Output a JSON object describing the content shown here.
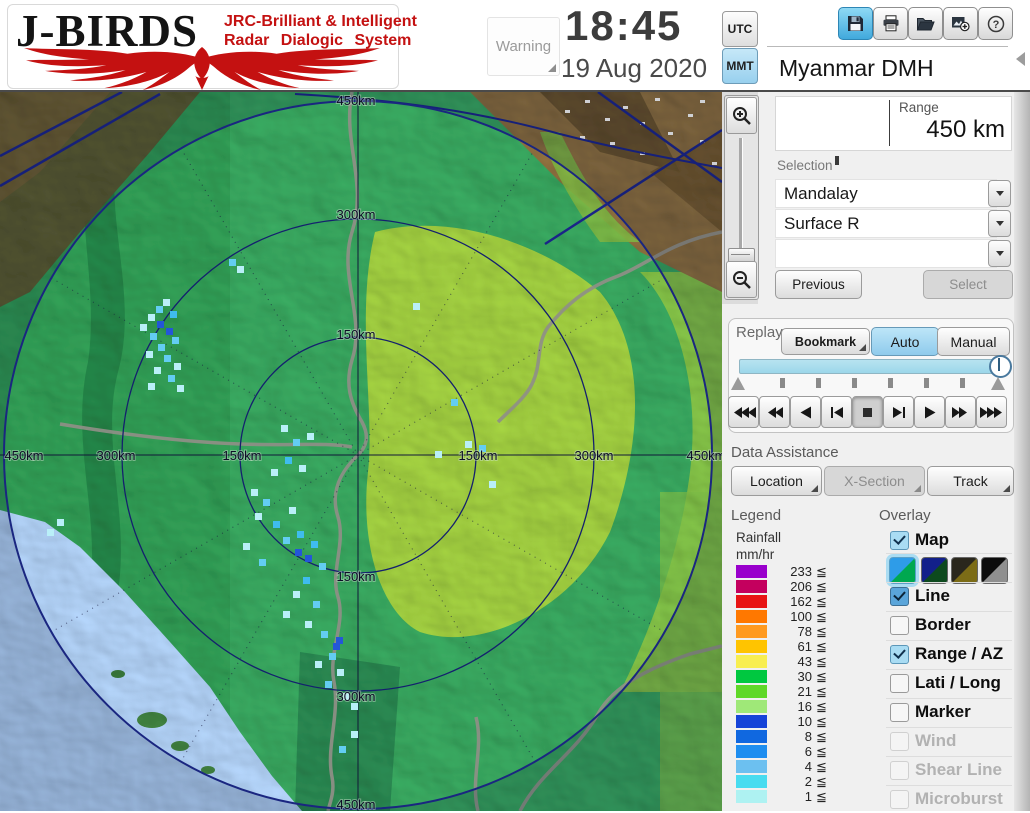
{
  "header": {
    "logo": {
      "title": "J-BIRDS",
      "tagline_line1": "JRC-Brilliant & Intelligent",
      "tagline_line2": "Radar Dialogic System"
    },
    "warning_label": "Warning",
    "clock": {
      "time": "18:45",
      "date": "19 Aug 2020",
      "utc_label": "UTC",
      "mmt_label": "MMT",
      "selected_timezone": "MMT"
    },
    "toolbar_icons": [
      "save",
      "print",
      "open-folder",
      "add-image",
      "help"
    ]
  },
  "station_name": "Myanmar DMH",
  "range": {
    "label": "Range",
    "value": "450 km"
  },
  "selection": {
    "label": "Selection",
    "dropdowns": [
      "Mandalay",
      "Surface R",
      ""
    ],
    "previous_label": "Previous",
    "select_label": "Select"
  },
  "replay": {
    "label": "Replay",
    "bookmark_label": "Bookmark",
    "auto_label": "Auto",
    "manual_label": "Manual",
    "mode_selected": "Auto",
    "playback_icons": [
      "fastest-rewind",
      "fast-rewind",
      "play-backward",
      "step-backward",
      "stop",
      "step-forward",
      "play-forward",
      "fast-forward",
      "fastest-forward"
    ],
    "active_playback": "stop"
  },
  "data_assistance": {
    "label": "Data Assistance",
    "location_label": "Location",
    "xsection_label": "X-Section",
    "track_label": "Track"
  },
  "legend": {
    "label": "Legend",
    "unit_line1": "Rainfall",
    "unit_line2": "mm/hr",
    "le_symbol": "≦",
    "entries": [
      {
        "v": "233",
        "color": "#9900cc"
      },
      {
        "v": "206",
        "color": "#c4005e"
      },
      {
        "v": "162",
        "color": "#e81414"
      },
      {
        "v": "100",
        "color": "#ff7800"
      },
      {
        "v": "78",
        "color": "#ff9a20"
      },
      {
        "v": "61",
        "color": "#ffc400"
      },
      {
        "v": "43",
        "color": "#f8ee50"
      },
      {
        "v": "30",
        "color": "#00c840"
      },
      {
        "v": "21",
        "color": "#5fd828"
      },
      {
        "v": "16",
        "color": "#9fe878"
      },
      {
        "v": "10",
        "color": "#1543d8"
      },
      {
        "v": "8",
        "color": "#1068e0"
      },
      {
        "v": "6",
        "color": "#1e8ef0"
      },
      {
        "v": "4",
        "color": "#6cc0f0"
      },
      {
        "v": "2",
        "color": "#48dcf0"
      },
      {
        "v": "1",
        "color": "#aef2f2"
      }
    ]
  },
  "overlay": {
    "label": "Overlay",
    "items": [
      {
        "label": "Map",
        "state": "checked"
      },
      {
        "label": "Line",
        "state": "checked-dark"
      },
      {
        "label": "Border",
        "state": "unchecked"
      },
      {
        "label": "Range / AZ",
        "state": "checked"
      },
      {
        "label": "Lati / Long",
        "state": "unchecked"
      },
      {
        "label": "Marker",
        "state": "unchecked"
      },
      {
        "label": "Wind",
        "state": "disabled"
      },
      {
        "label": "Shear Line",
        "state": "disabled"
      },
      {
        "label": "Microburst",
        "state": "disabled"
      }
    ],
    "map_swatches": [
      {
        "c1": "#2e9ce8",
        "c2": "#00a850"
      },
      {
        "c1": "#12208a",
        "c2": "#0d4a1e"
      },
      {
        "c1": "#2a271d",
        "c2": "#7c6c16"
      },
      {
        "c1": "#0c0c0c",
        "c2": "#8f8f8f"
      }
    ],
    "selected_swatch": 1
  },
  "map": {
    "ring_labels": {
      "r150": "150km",
      "r300": "300km",
      "r450": "450km"
    },
    "range_rings_km": [
      150,
      300,
      450
    ],
    "zoom_icons": [
      "zoom-in",
      "zoom-out"
    ]
  }
}
